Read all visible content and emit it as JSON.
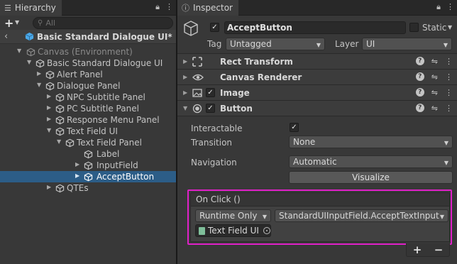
{
  "hierarchy": {
    "tab_label": "Hierarchy",
    "search_placeholder": "All",
    "scene_title": "Basic Standard Dialogue UI*",
    "nodes": [
      {
        "label": "Canvas (Environment)"
      },
      {
        "label": "Basic Standard Dialogue UI"
      },
      {
        "label": "Alert Panel"
      },
      {
        "label": "Dialogue Panel"
      },
      {
        "label": "NPC Subtitle Panel"
      },
      {
        "label": "PC Subtitle Panel"
      },
      {
        "label": "Response Menu Panel"
      },
      {
        "label": "Text Field UI"
      },
      {
        "label": "Text Field Panel"
      },
      {
        "label": "Label"
      },
      {
        "label": "InputField"
      },
      {
        "label": "AcceptButton"
      },
      {
        "label": "QTEs"
      }
    ]
  },
  "inspector": {
    "tab_label": "Inspector",
    "object_name": "AcceptButton",
    "static_label": "Static",
    "tag_label": "Tag",
    "tag_value": "Untagged",
    "layer_label": "Layer",
    "layer_value": "UI",
    "components": [
      {
        "label": "Rect Transform"
      },
      {
        "label": "Canvas Renderer"
      },
      {
        "label": "Image"
      },
      {
        "label": "Button"
      }
    ],
    "button": {
      "interactable_label": "Interactable",
      "transition_label": "Transition",
      "transition_value": "None",
      "navigation_label": "Navigation",
      "navigation_value": "Automatic",
      "visualize_label": "Visualize"
    },
    "on_click": {
      "header": "On Click ()",
      "runtime_value": "Runtime Only",
      "function_value": "StandardUIInputField.AcceptTextInput",
      "object_value": "Text Field UI",
      "add_label": "+",
      "remove_label": "−"
    }
  },
  "colors": {
    "selection": "#2c5d87",
    "highlight_border": "#e020c8",
    "panel_bg": "#383838"
  }
}
